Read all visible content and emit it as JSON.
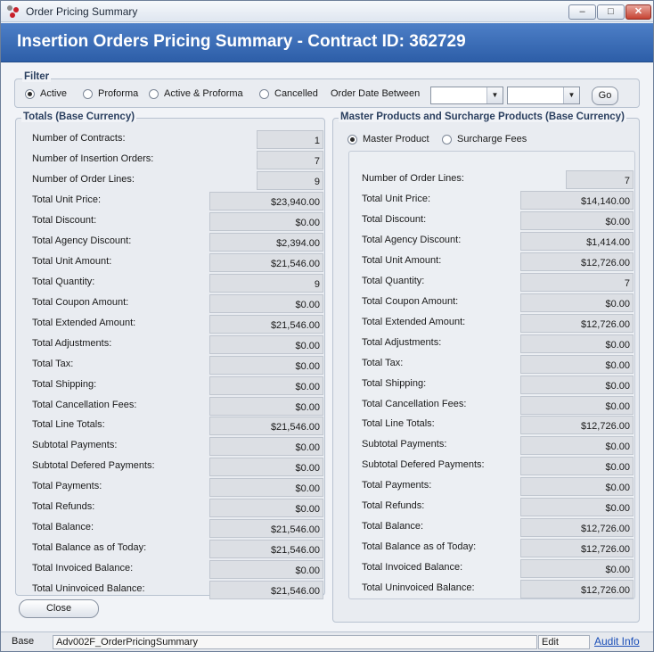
{
  "window": {
    "title": "Order Pricing Summary"
  },
  "header": {
    "title": "Insertion Orders Pricing Summary - Contract ID: 362729"
  },
  "filter": {
    "label": "Filter",
    "options": [
      "Active",
      "Proforma",
      "Active & Proforma",
      "Cancelled"
    ],
    "selected": "Active",
    "date_label": "Order Date Between",
    "date_from": "",
    "date_to": "",
    "go_label": "Go"
  },
  "totals": {
    "title": "Totals (Base Currency)",
    "rows": [
      {
        "label": "Number of Contracts:",
        "value": "1"
      },
      {
        "label": "Number of Insertion Orders:",
        "value": "7"
      },
      {
        "label": "Number of Order Lines:",
        "value": "9"
      },
      {
        "label": "Total Unit Price:",
        "value": "$23,940.00"
      },
      {
        "label": "Total Discount:",
        "value": "$0.00"
      },
      {
        "label": "Total Agency Discount:",
        "value": "$2,394.00"
      },
      {
        "label": "Total Unit Amount:",
        "value": "$21,546.00"
      },
      {
        "label": "Total Quantity:",
        "value": "9"
      },
      {
        "label": "Total Coupon Amount:",
        "value": "$0.00"
      },
      {
        "label": "Total Extended Amount:",
        "value": "$21,546.00"
      },
      {
        "label": "Total Adjustments:",
        "value": "$0.00"
      },
      {
        "label": "Total Tax:",
        "value": "$0.00"
      },
      {
        "label": "Total Shipping:",
        "value": "$0.00"
      },
      {
        "label": "Total Cancellation Fees:",
        "value": "$0.00"
      },
      {
        "label": "Total Line Totals:",
        "value": "$21,546.00"
      },
      {
        "label": "Subtotal Payments:",
        "value": "$0.00"
      },
      {
        "label": "Subtotal Defered Payments:",
        "value": "$0.00"
      },
      {
        "label": "Total Payments:",
        "value": "$0.00"
      },
      {
        "label": "Total Refunds:",
        "value": "$0.00"
      },
      {
        "label": "Total Balance:",
        "value": "$21,546.00"
      },
      {
        "label": "Total Balance as of Today:",
        "value": "$21,546.00"
      },
      {
        "label": "Total Invoiced Balance:",
        "value": "$0.00"
      },
      {
        "label": "Total Uninvoiced Balance:",
        "value": "$21,546.00"
      }
    ]
  },
  "master": {
    "title": "Master Products and Surcharge Products (Base Currency)",
    "options": [
      "Master Product",
      "Surcharge Fees"
    ],
    "selected": "Master Product",
    "rows": [
      {
        "label": "Number of Order Lines:",
        "value": "7"
      },
      {
        "label": "Total Unit Price:",
        "value": "$14,140.00"
      },
      {
        "label": "Total Discount:",
        "value": "$0.00"
      },
      {
        "label": "Total Agency Discount:",
        "value": "$1,414.00"
      },
      {
        "label": "Total Unit Amount:",
        "value": "$12,726.00"
      },
      {
        "label": "Total Quantity:",
        "value": "7"
      },
      {
        "label": "Total Coupon Amount:",
        "value": "$0.00"
      },
      {
        "label": "Total Extended Amount:",
        "value": "$12,726.00"
      },
      {
        "label": "Total Adjustments:",
        "value": "$0.00"
      },
      {
        "label": "Total Tax:",
        "value": "$0.00"
      },
      {
        "label": "Total Shipping:",
        "value": "$0.00"
      },
      {
        "label": "Total Cancellation Fees:",
        "value": "$0.00"
      },
      {
        "label": "Total Line Totals:",
        "value": "$12,726.00"
      },
      {
        "label": "Subtotal Payments:",
        "value": "$0.00"
      },
      {
        "label": "Subtotal Defered Payments:",
        "value": "$0.00"
      },
      {
        "label": "Total Payments:",
        "value": "$0.00"
      },
      {
        "label": "Total Refunds:",
        "value": "$0.00"
      },
      {
        "label": "Total Balance:",
        "value": "$12,726.00"
      },
      {
        "label": "Total Balance as of Today:",
        "value": "$12,726.00"
      },
      {
        "label": "Total Invoiced Balance:",
        "value": "$0.00"
      },
      {
        "label": "Total Uninvoiced Balance:",
        "value": "$12,726.00"
      }
    ]
  },
  "close_label": "Close",
  "status": {
    "mode": "Base",
    "form": "Adv002F_OrderPricingSummary",
    "state": "Edit",
    "link": "Audit Info"
  }
}
